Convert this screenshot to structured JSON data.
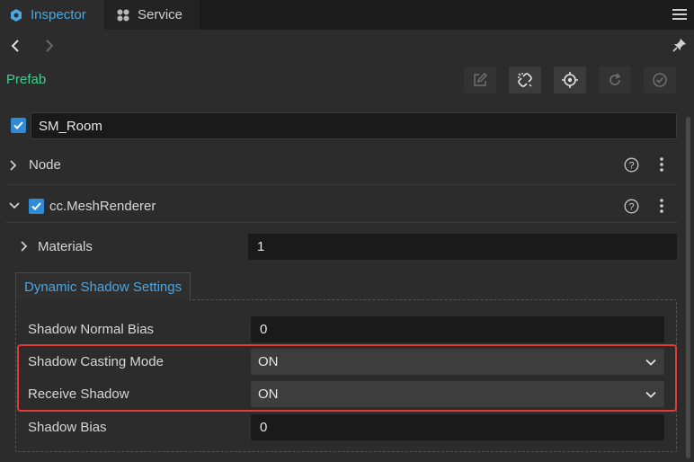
{
  "tabs": [
    {
      "label": "Inspector",
      "icon": "inspector-icon",
      "active": true
    },
    {
      "label": "Service",
      "icon": "service-icon",
      "active": false
    }
  ],
  "header": {
    "prefab_label": "Prefab"
  },
  "node_name": "SM_Room",
  "sections": {
    "node": {
      "label": "Node"
    },
    "mesh_renderer": {
      "label": "cc.MeshRenderer"
    }
  },
  "materials": {
    "label": "Materials",
    "value": "1"
  },
  "shadow_group": {
    "title": "Dynamic Shadow Settings",
    "normal_bias": {
      "label": "Shadow Normal Bias",
      "value": "0"
    },
    "casting_mode": {
      "label": "Shadow Casting Mode",
      "value": "ON"
    },
    "receive_shadow": {
      "label": "Receive Shadow",
      "value": "ON"
    },
    "shadow_bias": {
      "label": "Shadow Bias",
      "value": "0"
    }
  },
  "colors": {
    "accent_blue": "#4da6e0",
    "prefab_green": "#3fcf8e",
    "highlight_red": "#e53935",
    "checkbox_blue": "#2f8bd6"
  }
}
